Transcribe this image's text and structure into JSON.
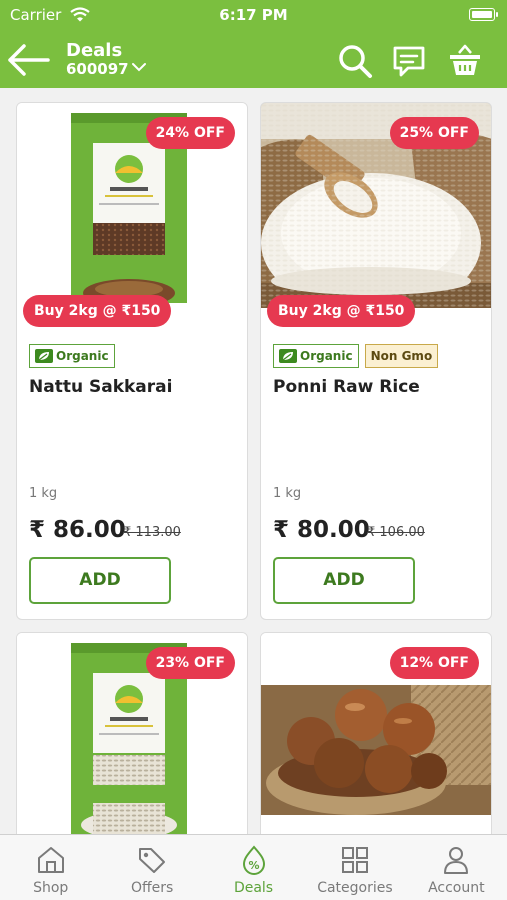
{
  "status_bar": {
    "carrier": "Carrier",
    "time": "6:17 PM"
  },
  "header": {
    "title": "Deals",
    "pincode": "600097"
  },
  "products": [
    {
      "discount": "24% OFF",
      "offer": "Buy 2kg @ ₹150",
      "tags": [
        "Organic"
      ],
      "name": "Nattu Sakkarai",
      "quantity": "1 kg",
      "price": "₹ 86.00",
      "mrp": "₹ 113.00",
      "add_label": "ADD"
    },
    {
      "discount": "25% OFF",
      "offer": "Buy 2kg @ ₹150",
      "tags": [
        "Organic",
        "Non Gmo"
      ],
      "name": "Ponni Raw Rice",
      "quantity": "1 kg",
      "price": "₹ 80.00",
      "mrp": "₹ 106.00",
      "add_label": "ADD"
    },
    {
      "discount": "23% OFF"
    },
    {
      "discount": "12% OFF"
    }
  ],
  "package_brand": "ORGFARM",
  "tabs": [
    {
      "label": "Shop",
      "icon": "home-icon"
    },
    {
      "label": "Offers",
      "icon": "tag-icon"
    },
    {
      "label": "Deals",
      "icon": "deals-icon",
      "active": true
    },
    {
      "label": "Categories",
      "icon": "grid-icon"
    },
    {
      "label": "Account",
      "icon": "person-icon"
    }
  ],
  "colors": {
    "brand_green": "#7bbf3f",
    "badge_red": "#e63950",
    "accent_green": "#5da33b"
  }
}
